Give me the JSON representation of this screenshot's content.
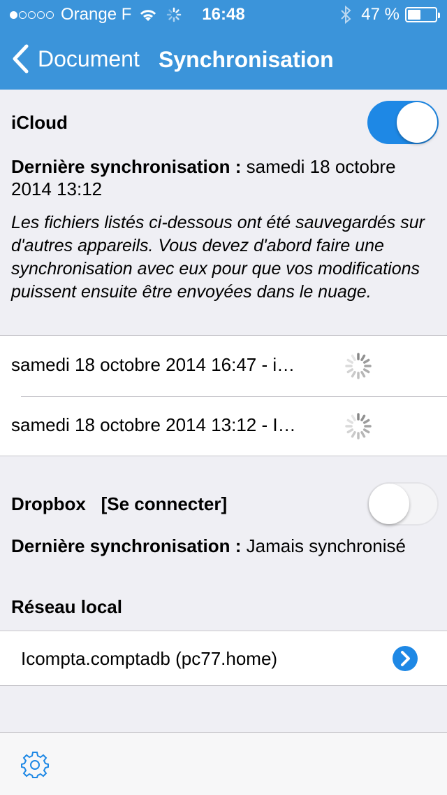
{
  "status_bar": {
    "signal_dots": [
      true,
      false,
      false,
      false,
      false
    ],
    "carrier": "Orange F",
    "time": "16:48",
    "battery_percent": "47 %",
    "battery_level": 0.47,
    "icons": [
      "wifi-icon",
      "activity-spinner-icon",
      "bluetooth-icon",
      "battery-icon"
    ]
  },
  "nav": {
    "back_label": "Document",
    "title": "Synchronisation"
  },
  "icloud": {
    "title": "iCloud",
    "toggle_on": true,
    "last_sync_label": "Dernière synchronisation :",
    "last_sync_value": " samedi 18 octobre 2014 13:12",
    "note": "Les fichiers listés ci-dessous ont été sauvegardés sur d'autres appareils. Vous devez d'abord faire une synchronisation avec eux pour que vos modifications puissent ensuite être envoyées dans le nuage.",
    "files": [
      {
        "label": "samedi 18 octobre 2014 16:47 - i…"
      },
      {
        "label": "samedi 18 octobre 2014 13:12 - I…"
      }
    ]
  },
  "dropbox": {
    "title": "Dropbox",
    "connect_link": "[Se connecter]",
    "toggle_on": false,
    "last_sync_label": "Dernière synchronisation :",
    "last_sync_value": " Jamais synchronisé"
  },
  "local_network": {
    "title": "Réseau local",
    "items": [
      {
        "label": "Icompta.comptadb (pc77.home)"
      }
    ]
  },
  "colors": {
    "accent": "#3b94da",
    "toggle_on": "#1e88e5",
    "background": "#efeff4"
  }
}
